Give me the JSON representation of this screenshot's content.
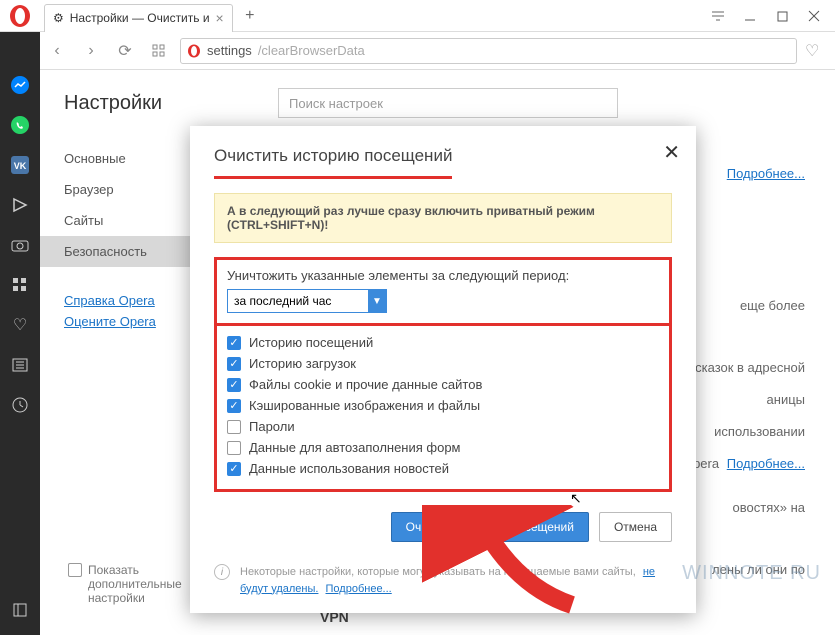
{
  "tab": {
    "title": "Настройки — Очистить и"
  },
  "address": {
    "proto": "settings",
    "path": "/clearBrowserData"
  },
  "settings": {
    "title": "Настройки",
    "search_placeholder": "Поиск настроек",
    "nav": [
      "Основные",
      "Браузер",
      "Сайты",
      "Безопасность"
    ],
    "links": [
      "Справка Opera",
      "Оцените Opera"
    ],
    "extra_checkbox": "Показать дополнительные настройки",
    "bg_more1": "Подробнее...",
    "bg_line1": "еще более",
    "bg_line2": "дсказок в адресной",
    "bg_line3": "аницы",
    "bg_line4": "использовании",
    "bg_line5": "Opera",
    "bg_more2": "Подробнее...",
    "bg_line6": "овостях» на",
    "bg_line7": "лены ли они по",
    "vpn": "VPN"
  },
  "modal": {
    "title": "Очистить историю посещений",
    "tip": "А в следующий раз лучше сразу включить приватный режим (CTRL+SHIFT+N)!",
    "period_label": "Уничтожить указанные элементы за следующий период:",
    "period_selected": "за последний час",
    "checks": [
      {
        "label": "Историю посещений",
        "on": true
      },
      {
        "label": "Историю загрузок",
        "on": true
      },
      {
        "label": "Файлы cookie и прочие данные сайтов",
        "on": true
      },
      {
        "label": "Кэшированные изображения и файлы",
        "on": true
      },
      {
        "label": "Пароли",
        "on": false
      },
      {
        "label": "Данные для автозаполнения форм",
        "on": false
      },
      {
        "label": "Данные использования новостей",
        "on": true
      }
    ],
    "btn_clear": "Очистить историю посещений",
    "btn_cancel": "Отмена",
    "footnote_text": "Некоторые настройки, которые могут указывать на посещаемые вами сайты,",
    "footnote_link1": "не будут удалены.",
    "footnote_link2": "Подробнее..."
  },
  "watermark": "WINNOTE RU"
}
